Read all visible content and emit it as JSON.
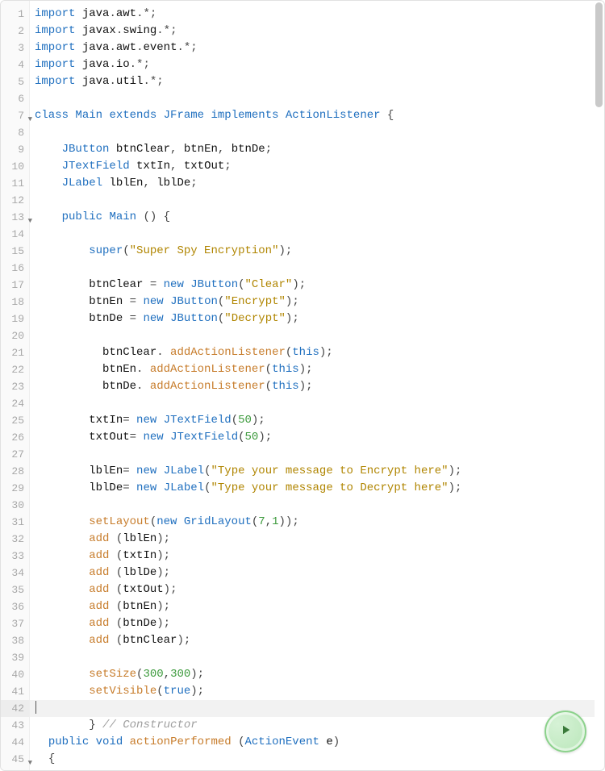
{
  "active_line": 42,
  "fold_lines": [
    7,
    13,
    45
  ],
  "lines": [
    {
      "n": 1,
      "tokens": [
        [
          "kw",
          "import"
        ],
        [
          "punct",
          " "
        ],
        [
          "ident",
          "java"
        ],
        [
          "punct",
          "."
        ],
        [
          "ident",
          "awt"
        ],
        [
          "punct",
          ".*;"
        ]
      ]
    },
    {
      "n": 2,
      "tokens": [
        [
          "kw",
          "import"
        ],
        [
          "punct",
          " "
        ],
        [
          "ident",
          "javax"
        ],
        [
          "punct",
          "."
        ],
        [
          "ident",
          "swing"
        ],
        [
          "punct",
          ".*;"
        ]
      ]
    },
    {
      "n": 3,
      "tokens": [
        [
          "kw",
          "import"
        ],
        [
          "punct",
          " "
        ],
        [
          "ident",
          "java"
        ],
        [
          "punct",
          "."
        ],
        [
          "ident",
          "awt"
        ],
        [
          "punct",
          "."
        ],
        [
          "ident",
          "event"
        ],
        [
          "punct",
          ".*;"
        ]
      ]
    },
    {
      "n": 4,
      "tokens": [
        [
          "kw",
          "import"
        ],
        [
          "punct",
          " "
        ],
        [
          "ident",
          "java"
        ],
        [
          "punct",
          "."
        ],
        [
          "ident",
          "io"
        ],
        [
          "punct",
          ".*;"
        ]
      ]
    },
    {
      "n": 5,
      "tokens": [
        [
          "kw",
          "import"
        ],
        [
          "punct",
          " "
        ],
        [
          "ident",
          "java"
        ],
        [
          "punct",
          "."
        ],
        [
          "ident",
          "util"
        ],
        [
          "punct",
          ".*;"
        ]
      ]
    },
    {
      "n": 6,
      "tokens": []
    },
    {
      "n": 7,
      "tokens": [
        [
          "kw",
          "class"
        ],
        [
          "punct",
          " "
        ],
        [
          "type",
          "Main"
        ],
        [
          "punct",
          " "
        ],
        [
          "kw",
          "extends"
        ],
        [
          "punct",
          " "
        ],
        [
          "type",
          "JFrame"
        ],
        [
          "punct",
          " "
        ],
        [
          "kw",
          "implements"
        ],
        [
          "punct",
          " "
        ],
        [
          "type",
          "ActionListener"
        ],
        [
          "punct",
          " {"
        ]
      ]
    },
    {
      "n": 8,
      "tokens": []
    },
    {
      "n": 9,
      "indent": 2,
      "tokens": [
        [
          "type",
          "JButton"
        ],
        [
          "punct",
          " "
        ],
        [
          "ident",
          "btnClear"
        ],
        [
          "punct",
          ", "
        ],
        [
          "ident",
          "btnEn"
        ],
        [
          "punct",
          ", "
        ],
        [
          "ident",
          "btnDe"
        ],
        [
          "punct",
          ";"
        ]
      ]
    },
    {
      "n": 10,
      "indent": 2,
      "tokens": [
        [
          "type",
          "JTextField"
        ],
        [
          "punct",
          " "
        ],
        [
          "ident",
          "txtIn"
        ],
        [
          "punct",
          ", "
        ],
        [
          "ident",
          "txtOut"
        ],
        [
          "punct",
          ";"
        ]
      ]
    },
    {
      "n": 11,
      "indent": 2,
      "tokens": [
        [
          "type",
          "JLabel"
        ],
        [
          "punct",
          " "
        ],
        [
          "ident",
          "lblEn"
        ],
        [
          "punct",
          ", "
        ],
        [
          "ident",
          "lblDe"
        ],
        [
          "punct",
          ";"
        ]
      ]
    },
    {
      "n": 12,
      "tokens": []
    },
    {
      "n": 13,
      "indent": 2,
      "tokens": [
        [
          "kw",
          "public"
        ],
        [
          "punct",
          " "
        ],
        [
          "type",
          "Main"
        ],
        [
          "punct",
          " () {"
        ]
      ]
    },
    {
      "n": 14,
      "tokens": []
    },
    {
      "n": 15,
      "indent": 4,
      "tokens": [
        [
          "kw",
          "super"
        ],
        [
          "punct",
          "("
        ],
        [
          "str",
          "\"Super Spy Encryption\""
        ],
        [
          "punct",
          ");"
        ]
      ]
    },
    {
      "n": 16,
      "tokens": []
    },
    {
      "n": 17,
      "indent": 4,
      "tokens": [
        [
          "ident",
          "btnClear"
        ],
        [
          "punct",
          " "
        ],
        [
          "op",
          "="
        ],
        [
          "punct",
          " "
        ],
        [
          "kw",
          "new"
        ],
        [
          "punct",
          " "
        ],
        [
          "type",
          "JButton"
        ],
        [
          "punct",
          "("
        ],
        [
          "str",
          "\"Clear\""
        ],
        [
          "punct",
          ");"
        ]
      ]
    },
    {
      "n": 18,
      "indent": 4,
      "tokens": [
        [
          "ident",
          "btnEn"
        ],
        [
          "punct",
          " "
        ],
        [
          "op",
          "="
        ],
        [
          "punct",
          " "
        ],
        [
          "kw",
          "new"
        ],
        [
          "punct",
          " "
        ],
        [
          "type",
          "JButton"
        ],
        [
          "punct",
          "("
        ],
        [
          "str",
          "\"Encrypt\""
        ],
        [
          "punct",
          ");"
        ]
      ]
    },
    {
      "n": 19,
      "indent": 4,
      "tokens": [
        [
          "ident",
          "btnDe"
        ],
        [
          "punct",
          " "
        ],
        [
          "op",
          "="
        ],
        [
          "punct",
          " "
        ],
        [
          "kw",
          "new"
        ],
        [
          "punct",
          " "
        ],
        [
          "type",
          "JButton"
        ],
        [
          "punct",
          "("
        ],
        [
          "str",
          "\"Decrypt\""
        ],
        [
          "punct",
          ");"
        ]
      ]
    },
    {
      "n": 20,
      "tokens": []
    },
    {
      "n": 21,
      "indent": 5,
      "tokens": [
        [
          "ident",
          "btnClear"
        ],
        [
          "punct",
          ". "
        ],
        [
          "call",
          "addActionListener"
        ],
        [
          "punct",
          "("
        ],
        [
          "kw",
          "this"
        ],
        [
          "punct",
          ");"
        ]
      ]
    },
    {
      "n": 22,
      "indent": 5,
      "tokens": [
        [
          "ident",
          "btnEn"
        ],
        [
          "punct",
          ". "
        ],
        [
          "call",
          "addActionListener"
        ],
        [
          "punct",
          "("
        ],
        [
          "kw",
          "this"
        ],
        [
          "punct",
          ");"
        ]
      ]
    },
    {
      "n": 23,
      "indent": 5,
      "tokens": [
        [
          "ident",
          "btnDe"
        ],
        [
          "punct",
          ". "
        ],
        [
          "call",
          "addActionListener"
        ],
        [
          "punct",
          "("
        ],
        [
          "kw",
          "this"
        ],
        [
          "punct",
          ");"
        ]
      ]
    },
    {
      "n": 24,
      "tokens": []
    },
    {
      "n": 25,
      "indent": 4,
      "tokens": [
        [
          "ident",
          "txtIn"
        ],
        [
          "op",
          "="
        ],
        [
          "punct",
          " "
        ],
        [
          "kw",
          "new"
        ],
        [
          "punct",
          " "
        ],
        [
          "type",
          "JTextField"
        ],
        [
          "punct",
          "("
        ],
        [
          "num",
          "50"
        ],
        [
          "punct",
          ");"
        ]
      ]
    },
    {
      "n": 26,
      "indent": 4,
      "tokens": [
        [
          "ident",
          "txtOut"
        ],
        [
          "op",
          "="
        ],
        [
          "punct",
          " "
        ],
        [
          "kw",
          "new"
        ],
        [
          "punct",
          " "
        ],
        [
          "type",
          "JTextField"
        ],
        [
          "punct",
          "("
        ],
        [
          "num",
          "50"
        ],
        [
          "punct",
          ");"
        ]
      ]
    },
    {
      "n": 27,
      "tokens": []
    },
    {
      "n": 28,
      "indent": 4,
      "tokens": [
        [
          "ident",
          "lblEn"
        ],
        [
          "op",
          "="
        ],
        [
          "punct",
          " "
        ],
        [
          "kw",
          "new"
        ],
        [
          "punct",
          " "
        ],
        [
          "type",
          "JLabel"
        ],
        [
          "punct",
          "("
        ],
        [
          "str",
          "\"Type your message to Encrypt here\""
        ],
        [
          "punct",
          ");"
        ]
      ]
    },
    {
      "n": 29,
      "indent": 4,
      "tokens": [
        [
          "ident",
          "lblDe"
        ],
        [
          "op",
          "="
        ],
        [
          "punct",
          " "
        ],
        [
          "kw",
          "new"
        ],
        [
          "punct",
          " "
        ],
        [
          "type",
          "JLabel"
        ],
        [
          "punct",
          "("
        ],
        [
          "str",
          "\"Type your message to Decrypt here\""
        ],
        [
          "punct",
          ");"
        ]
      ]
    },
    {
      "n": 30,
      "tokens": []
    },
    {
      "n": 31,
      "indent": 4,
      "tokens": [
        [
          "call",
          "setLayout"
        ],
        [
          "punct",
          "("
        ],
        [
          "kw",
          "new"
        ],
        [
          "punct",
          " "
        ],
        [
          "type",
          "GridLayout"
        ],
        [
          "punct",
          "("
        ],
        [
          "num",
          "7"
        ],
        [
          "punct",
          ","
        ],
        [
          "num",
          "1"
        ],
        [
          "punct",
          "));"
        ]
      ]
    },
    {
      "n": 32,
      "indent": 4,
      "tokens": [
        [
          "call",
          "add"
        ],
        [
          "punct",
          " ("
        ],
        [
          "ident",
          "lblEn"
        ],
        [
          "punct",
          ");"
        ]
      ]
    },
    {
      "n": 33,
      "indent": 4,
      "tokens": [
        [
          "call",
          "add"
        ],
        [
          "punct",
          " ("
        ],
        [
          "ident",
          "txtIn"
        ],
        [
          "punct",
          ");"
        ]
      ]
    },
    {
      "n": 34,
      "indent": 4,
      "tokens": [
        [
          "call",
          "add"
        ],
        [
          "punct",
          " ("
        ],
        [
          "ident",
          "lblDe"
        ],
        [
          "punct",
          ");"
        ]
      ]
    },
    {
      "n": 35,
      "indent": 4,
      "tokens": [
        [
          "call",
          "add"
        ],
        [
          "punct",
          " ("
        ],
        [
          "ident",
          "txtOut"
        ],
        [
          "punct",
          ");"
        ]
      ]
    },
    {
      "n": 36,
      "indent": 4,
      "tokens": [
        [
          "call",
          "add"
        ],
        [
          "punct",
          " ("
        ],
        [
          "ident",
          "btnEn"
        ],
        [
          "punct",
          ");"
        ]
      ]
    },
    {
      "n": 37,
      "indent": 4,
      "tokens": [
        [
          "call",
          "add"
        ],
        [
          "punct",
          " ("
        ],
        [
          "ident",
          "btnDe"
        ],
        [
          "punct",
          ");"
        ]
      ]
    },
    {
      "n": 38,
      "indent": 4,
      "tokens": [
        [
          "call",
          "add"
        ],
        [
          "punct",
          " ("
        ],
        [
          "ident",
          "btnClear"
        ],
        [
          "punct",
          ");"
        ]
      ]
    },
    {
      "n": 39,
      "tokens": []
    },
    {
      "n": 40,
      "indent": 4,
      "tokens": [
        [
          "call",
          "setSize"
        ],
        [
          "punct",
          "("
        ],
        [
          "num",
          "300"
        ],
        [
          "punct",
          ","
        ],
        [
          "num",
          "300"
        ],
        [
          "punct",
          ");"
        ]
      ]
    },
    {
      "n": 41,
      "indent": 4,
      "tokens": [
        [
          "call",
          "setVisible"
        ],
        [
          "punct",
          "("
        ],
        [
          "bool",
          "true"
        ],
        [
          "punct",
          ");"
        ]
      ]
    },
    {
      "n": 42,
      "tokens": []
    },
    {
      "n": 43,
      "indent": 4,
      "tokens": [
        [
          "punct",
          "} "
        ],
        [
          "cmt",
          "// Constructor"
        ]
      ]
    },
    {
      "n": 44,
      "indent": 1,
      "tokens": [
        [
          "kw",
          "public"
        ],
        [
          "punct",
          " "
        ],
        [
          "kw",
          "void"
        ],
        [
          "punct",
          " "
        ],
        [
          "call",
          "actionPerformed"
        ],
        [
          "punct",
          " ("
        ],
        [
          "type",
          "ActionEvent"
        ],
        [
          "punct",
          " "
        ],
        [
          "ident",
          "e"
        ],
        [
          "punct",
          ")"
        ]
      ]
    },
    {
      "n": 45,
      "indent": 1,
      "tokens": [
        [
          "punct",
          "{"
        ]
      ]
    }
  ],
  "run_button": {
    "label": "Run"
  }
}
